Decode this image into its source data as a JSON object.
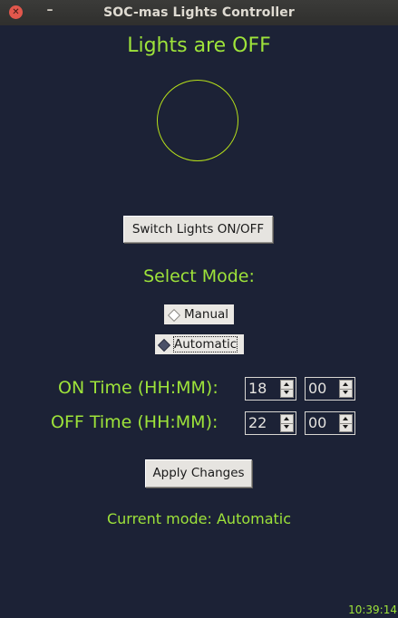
{
  "window": {
    "title": "SOC-mas Lights Controller",
    "close_glyph": "✕",
    "minimize_glyph": "–"
  },
  "status": {
    "text": "Lights are OFF",
    "lights_on": false
  },
  "buttons": {
    "switch_label": "Switch Lights ON/OFF",
    "apply_label": "Apply Changes"
  },
  "mode": {
    "heading": "Select Mode:",
    "options": [
      {
        "label": "Manual",
        "selected": false
      },
      {
        "label": "Automatic",
        "selected": true
      }
    ],
    "current_text": "Current mode: Automatic"
  },
  "schedule": {
    "on_label": "ON Time (HH:MM):",
    "on_hour": "18",
    "on_minute": "00",
    "off_label": "OFF Time (HH:MM):",
    "off_hour": "22",
    "off_minute": "00"
  },
  "clock": "10:39:14",
  "colors": {
    "background": "#1c2236",
    "accent_text": "#9ee33a",
    "indicator_off_outline": "#b6e01a",
    "close_button": "#e2574c"
  },
  "icons": {
    "close": "close-icon",
    "minimize": "minimize-icon",
    "spin_up": "arrow-up-icon",
    "spin_down": "arrow-down-icon"
  }
}
